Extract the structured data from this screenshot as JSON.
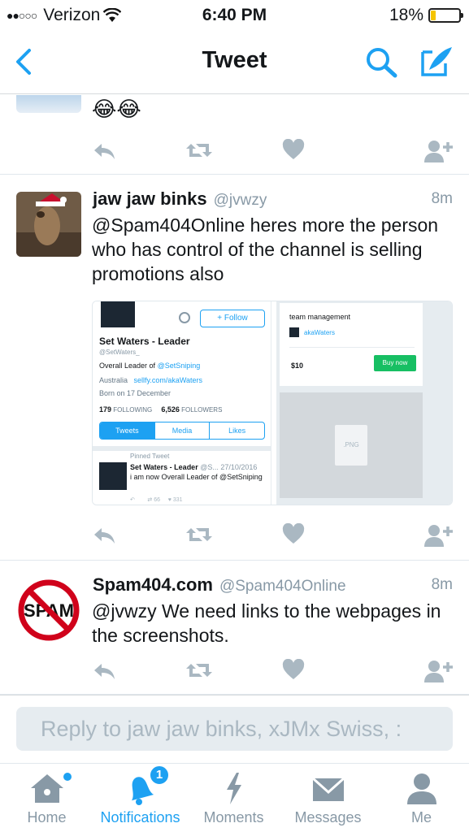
{
  "status": {
    "carrier": "Verizon",
    "time": "6:40 PM",
    "battery": "18%",
    "battery_level": 0.18
  },
  "nav": {
    "title": "Tweet"
  },
  "previous_tweet": {
    "emoji": "😂😂"
  },
  "tweets": [
    {
      "name": "jaw jaw binks",
      "handle": "@jvwzy",
      "time": "8m",
      "text": "@Spam404Online heres more the person who has control of the channel is selling promotions also",
      "media": {
        "profile": {
          "follow_label": "Follow",
          "name": "Set Waters - Leader",
          "handle": "@SetWaters_",
          "bio_prefix": "Overall Leader of",
          "bio_link": "@SetSniping",
          "location": "Australia",
          "website": "sellfy.com/akaWaters",
          "born": "Born on 17 December",
          "following_count": "179",
          "following_label": "FOLLOWING",
          "followers_count": "6,526",
          "followers_label": "FOLLOWERS",
          "tabs": [
            "Tweets",
            "Media",
            "Likes"
          ],
          "pinned_label": "Pinned Tweet",
          "pinned_name": "Set Waters - Leader",
          "pinned_meta": "@S...  27/10/2016",
          "pinned_text": "i am now Overall Leader of @SetSniping",
          "pinned_retweets": "66",
          "pinned_likes": "331"
        },
        "store": {
          "heading": "team management",
          "seller": "akaWaters",
          "price": "$10",
          "buy_label": "Buy now",
          "file_label": ".PNG"
        }
      }
    },
    {
      "name": "Spam404.com",
      "handle": "@Spam404Online",
      "time": "8m",
      "text": "@jvwzy We need links to the webpages in the screenshots.",
      "avatar_text": "SPAM"
    }
  ],
  "reply": {
    "placeholder": "Reply to jaw jaw binks, xJMx Swiss, :"
  },
  "tabbar": {
    "items": [
      {
        "label": "Home",
        "icon": "home-icon"
      },
      {
        "label": "Notifications",
        "icon": "bell-icon",
        "badge": "1"
      },
      {
        "label": "Moments",
        "icon": "lightning-icon"
      },
      {
        "label": "Messages",
        "icon": "envelope-icon"
      },
      {
        "label": "Me",
        "icon": "person-icon"
      }
    ]
  },
  "colors": {
    "accent": "#1da1f2",
    "icon_gray": "#aab8c2",
    "battery": "#f5c400",
    "spam_red": "#d0021b"
  }
}
